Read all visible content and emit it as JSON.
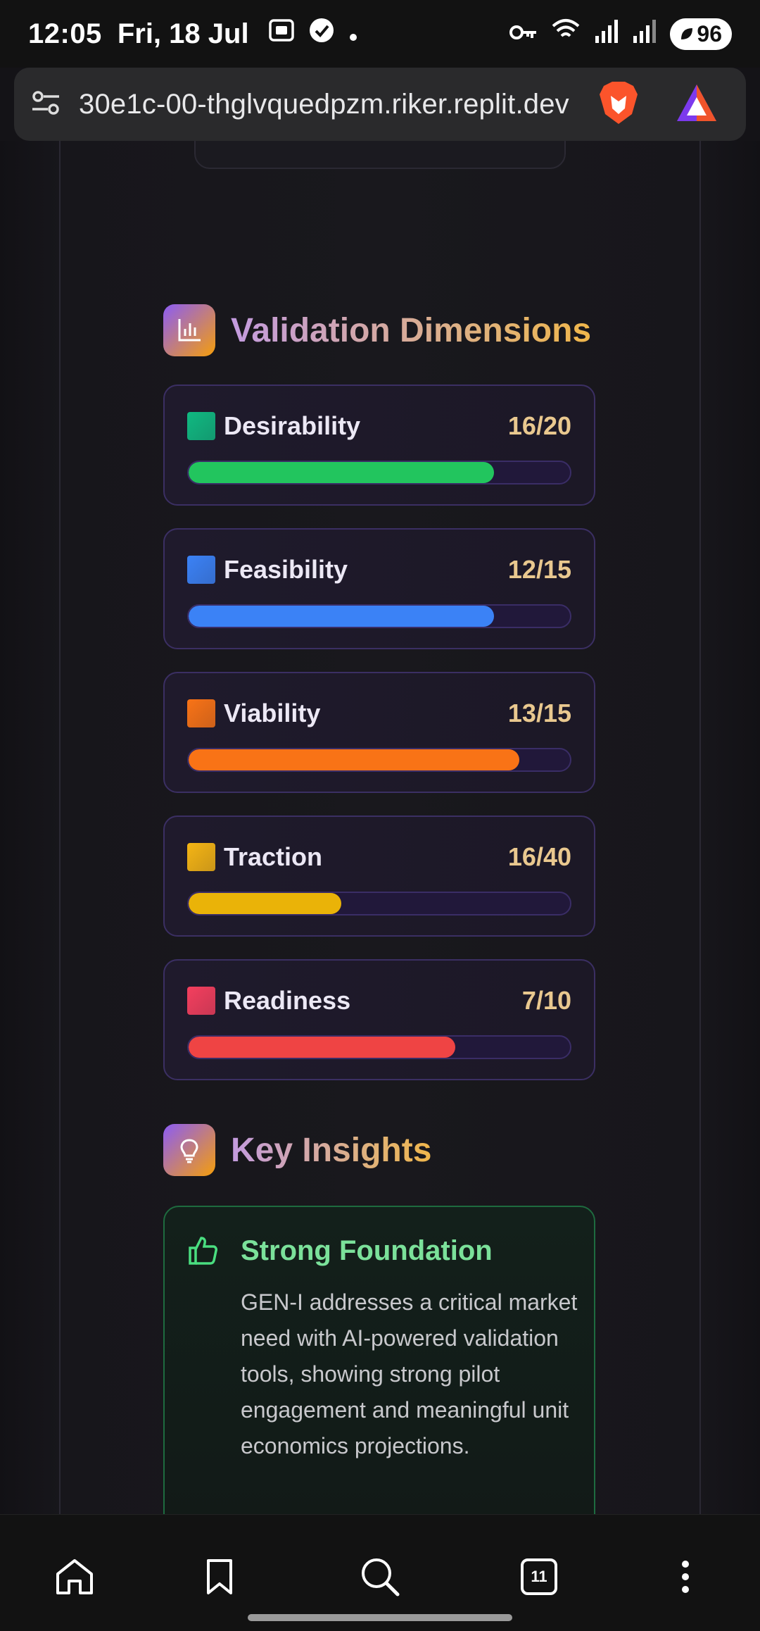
{
  "status_bar": {
    "time": "12:05",
    "date": "Fri, 18 Jul",
    "battery": "96"
  },
  "browser": {
    "url": "30e1c-00-thglvquedpzm.riker.replit.dev",
    "tab_count": "11"
  },
  "validation": {
    "title": "Validation Dimensions",
    "dimensions": [
      {
        "name": "Desirability",
        "score": "16/20",
        "fraction": 0.8,
        "color": "#22c55e",
        "swatch": "#10b981"
      },
      {
        "name": "Feasibility",
        "score": "12/15",
        "fraction": 0.8,
        "color": "#3b82f6",
        "swatch": "#3b82f6"
      },
      {
        "name": "Viability",
        "score": "13/15",
        "fraction": 0.867,
        "color": "#f97316",
        "swatch": "#f97316"
      },
      {
        "name": "Traction",
        "score": "16/40",
        "fraction": 0.4,
        "color": "#eab308",
        "swatch": "#f5b514"
      },
      {
        "name": "Readiness",
        "score": "7/10",
        "fraction": 0.7,
        "color": "#ef4444",
        "swatch": "#f43f5e"
      }
    ]
  },
  "insights": {
    "title": "Key Insights",
    "cards": [
      {
        "title": "Strong Foundation",
        "body": "GEN-I addresses a critical market need with AI-powered validation tools, showing strong pilot engagement and meaningful unit economics projections."
      }
    ]
  },
  "colors": {
    "accent_gradient_start": "#8b5cf6",
    "accent_gradient_end": "#f59e0b",
    "insight_green": "#7be19a"
  }
}
